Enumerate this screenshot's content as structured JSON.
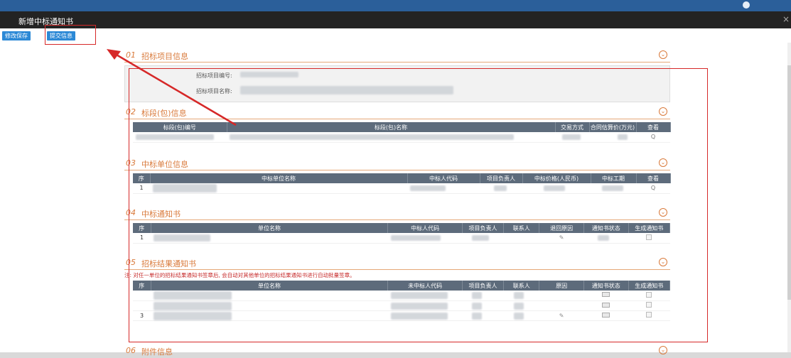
{
  "window": {
    "title": "新增中标通知书",
    "close_label": "×"
  },
  "toolbar": {
    "save_label": "修改保存",
    "submit_label": "提交信息"
  },
  "sections": [
    {
      "num": "01",
      "title": "招标项目信息",
      "chevron": "⌄"
    },
    {
      "num": "02",
      "title": "标段(包)信息",
      "chevron": "⌄"
    },
    {
      "num": "03",
      "title": "中标单位信息",
      "chevron": "⌄"
    },
    {
      "num": "04",
      "title": "中标通知书",
      "chevron": "⌄"
    },
    {
      "num": "05",
      "title": "招标结果通知书",
      "chevron": "⌄"
    },
    {
      "num": "06",
      "title": "附件信息",
      "chevron": "⌄"
    }
  ],
  "project_info": {
    "code_label": "招标项目编号:",
    "name_label": "招标项目名称:"
  },
  "bid_section_table": {
    "headers": [
      "标段(包)编号",
      "标段(包)名称",
      "交易方式",
      "合同估算价(万元)",
      "查看"
    ],
    "view_icon": "Q"
  },
  "winner_table": {
    "headers": [
      "序",
      "中标单位名称",
      "中标人代码",
      "项目负责人",
      "中标价格(人民币)",
      "中标工期",
      "查看"
    ],
    "rows": [
      {
        "seq": "1"
      }
    ],
    "view_icon": "Q"
  },
  "notice_table": {
    "headers": [
      "序",
      "单位名称",
      "中标人代码",
      "项目负责人",
      "联系人",
      "退回原因",
      "通知书状态",
      "生成通知书"
    ],
    "rows": [
      {
        "seq": "1"
      }
    ]
  },
  "result_notice": {
    "note": "注: 对任一单位的招标结果通知书签章后, 会自动对其他单位的招标结果通知书进行自动批量签章。",
    "headers": [
      "序",
      "单位名称",
      "未中标人代码",
      "项目负责人",
      "联系人",
      "原因",
      "通知书状态",
      "生成通知书"
    ],
    "rows": [
      {
        "seq": ""
      },
      {
        "seq": ""
      },
      {
        "seq": "3"
      }
    ],
    "edit_icon": "✎"
  },
  "colors": {
    "accent": "#2c89d6",
    "section_title": "#d97a3b",
    "table_header": "#5d6b7b",
    "highlight": "#d62828"
  }
}
